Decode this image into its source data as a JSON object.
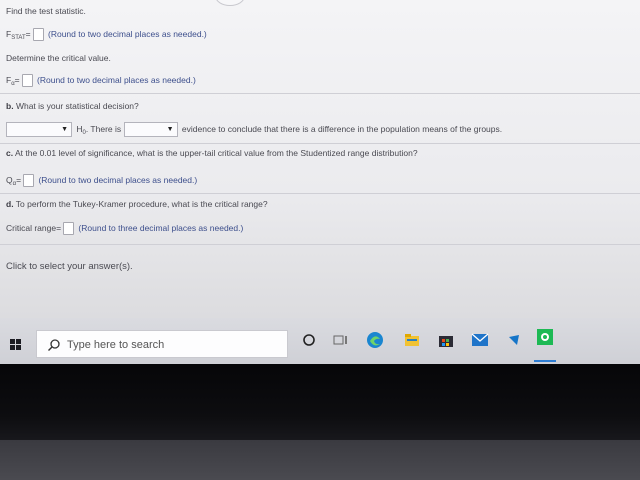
{
  "questions": {
    "find_stat": "Find the test statistic.",
    "fstat_label": "F",
    "fstat_sub": "STAT",
    "eq": "=",
    "round2": "(Round to two decimal places as needed.)",
    "det_crit": "Determine the critical value.",
    "falpha_label": "F",
    "alpha_sub": "α",
    "q_b": "b.",
    "b_text": "What is your statistical decision?",
    "h0_label": "H",
    "h0_sub": "0",
    "there_is": ". There is",
    "evidence_text": "evidence to conclude that there is a difference in the population means of the groups.",
    "q_c": "c.",
    "c_text": "At the 0.01 level of significance, what is the upper-tail critical value from the Studentized range distribution?",
    "qalpha_label": "Q",
    "q_d": "d.",
    "d_text": "To perform the Tukey-Kramer procedure, what is the critical range?",
    "crit_range_label": "Critical range",
    "round3": "(Round to three decimal places as needed.)",
    "click_select": "Click to select your answer(s)."
  },
  "taskbar": {
    "search_placeholder": "Type here to search"
  },
  "icons": [
    "windows-start-icon",
    "search-icon",
    "cortana-icon",
    "task-view-icon",
    "edge-icon",
    "file-explorer-icon",
    "store-icon",
    "mail-icon",
    "arrow-app-icon",
    "spotify-icon"
  ]
}
